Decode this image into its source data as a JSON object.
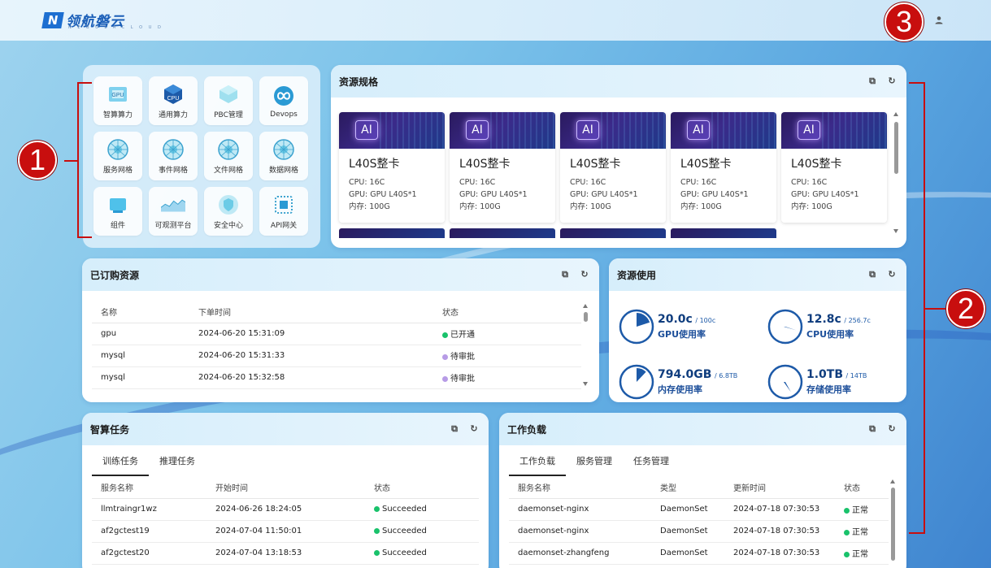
{
  "brand": {
    "name": "领航磐云",
    "sub": "N E B U L A  C L O U D"
  },
  "markers": [
    "1",
    "2",
    "3"
  ],
  "apps": [
    {
      "label": "智算算力",
      "icon": "gpu-icon"
    },
    {
      "label": "通用算力",
      "icon": "cpu-icon"
    },
    {
      "label": "PBC管理",
      "icon": "pbc-icon"
    },
    {
      "label": "Devops",
      "icon": "devops-icon"
    },
    {
      "label": "服务网格",
      "icon": "service-mesh-icon"
    },
    {
      "label": "事件网格",
      "icon": "event-mesh-icon"
    },
    {
      "label": "文件网格",
      "icon": "file-mesh-icon"
    },
    {
      "label": "数据网格",
      "icon": "data-mesh-icon"
    },
    {
      "label": "组件",
      "icon": "component-icon"
    },
    {
      "label": "可观测平台",
      "icon": "observability-icon"
    },
    {
      "label": "安全中心",
      "icon": "security-icon"
    },
    {
      "label": "API网关",
      "icon": "api-gateway-icon"
    }
  ],
  "specs": {
    "title": "资源规格",
    "items": [
      {
        "badge": "AI",
        "name": "L40S整卡",
        "cpu": "CPU: 16C",
        "gpu": "GPU: GPU L40S*1",
        "mem": "内存: 100G"
      },
      {
        "badge": "AI",
        "name": "L40S整卡",
        "cpu": "CPU: 16C",
        "gpu": "GPU: GPU L40S*1",
        "mem": "内存: 100G"
      },
      {
        "badge": "AI",
        "name": "L40S整卡",
        "cpu": "CPU: 16C",
        "gpu": "GPU: GPU L40S*1",
        "mem": "内存: 100G"
      },
      {
        "badge": "AI",
        "name": "L40S整卡",
        "cpu": "CPU: 16C",
        "gpu": "GPU: GPU L40S*1",
        "mem": "内存: 100G"
      },
      {
        "badge": "AI",
        "name": "L40S整卡",
        "cpu": "CPU: 16C",
        "gpu": "GPU: GPU L40S*1",
        "mem": "内存: 100G"
      }
    ]
  },
  "subscribed": {
    "title": "已订购资源",
    "columns": [
      "名称",
      "下单时间",
      "状态"
    ],
    "rows": [
      {
        "name": "gpu",
        "time": "2024-06-20 15:31:09",
        "status": "已开通",
        "color": "#19c26b"
      },
      {
        "name": "mysql",
        "time": "2024-06-20 15:31:33",
        "status": "待审批",
        "color": "#b79be6"
      },
      {
        "name": "mysql",
        "time": "2024-06-20 15:32:58",
        "status": "待审批",
        "color": "#b79be6"
      }
    ]
  },
  "usage": {
    "title": "资源使用",
    "items": [
      {
        "value": "20.0c",
        "max": "/ 100c",
        "label": "GPU使用率",
        "ratio": 0.2
      },
      {
        "value": "12.8c",
        "max": "/ 256.7c",
        "label": "CPU使用率",
        "ratio": 0.05
      },
      {
        "value": "794.0GB",
        "max": "/ 6.8TB",
        "label": "内存使用率",
        "ratio": 0.12
      },
      {
        "value": "1.0TB",
        "max": "/ 14TB",
        "label": "存储使用率",
        "ratio": 0.07
      }
    ]
  },
  "tasks": {
    "title": "智算任务",
    "tabs": [
      "训练任务",
      "推理任务"
    ],
    "columns": [
      "服务名称",
      "开始时间",
      "状态"
    ],
    "rows": [
      {
        "name": "llmtraingr1wz",
        "time": "2024-06-26 18:24:05",
        "status": "Succeeded"
      },
      {
        "name": "af2gctest19",
        "time": "2024-07-04 11:50:01",
        "status": "Succeeded"
      },
      {
        "name": "af2gctest20",
        "time": "2024-07-04 13:18:53",
        "status": "Succeeded"
      }
    ]
  },
  "workload": {
    "title": "工作负载",
    "tabs": [
      "工作负载",
      "服务管理",
      "任务管理"
    ],
    "columns": [
      "服务名称",
      "类型",
      "更新时间",
      "状态"
    ],
    "rows": [
      {
        "name": "daemonset-nginx",
        "type": "DaemonSet",
        "time": "2024-07-18 07:30:53",
        "status": "正常"
      },
      {
        "name": "daemonset-nginx",
        "type": "DaemonSet",
        "time": "2024-07-18 07:30:53",
        "status": "正常"
      },
      {
        "name": "daemonset-zhangfeng",
        "type": "DaemonSet",
        "time": "2024-07-18 07:30:53",
        "status": "正常"
      }
    ]
  },
  "colors": {
    "ok": "#19c26b",
    "accent": "#1d5aa8",
    "marker": "#c80e0e"
  }
}
